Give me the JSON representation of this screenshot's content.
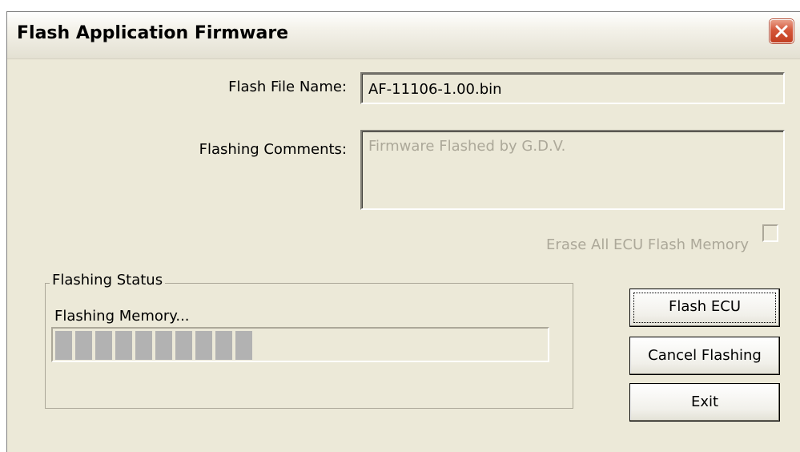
{
  "window": {
    "title": "Flash Application Firmware"
  },
  "form": {
    "flash_file_label": "Flash File Name:",
    "flash_file_value": "AF-11106-1.00.bin",
    "comments_label": "Flashing Comments:",
    "comments_value": "Firmware Flashed by G.D.V.",
    "erase_label": "Erase All ECU Flash Memory",
    "erase_checked": false
  },
  "status": {
    "group_title": "Flashing Status",
    "message": "Flashing Memory...",
    "progress_fraction": 0.4
  },
  "buttons": {
    "flash": "Flash ECU",
    "cancel": "Cancel Flashing",
    "exit": "Exit"
  },
  "icons": {
    "close": "close-icon"
  },
  "colors": {
    "window_bg": "#ece9d8",
    "close_red": "#d5573a",
    "progress_block": "#b2b2b2",
    "disabled_text": "#aca899"
  }
}
